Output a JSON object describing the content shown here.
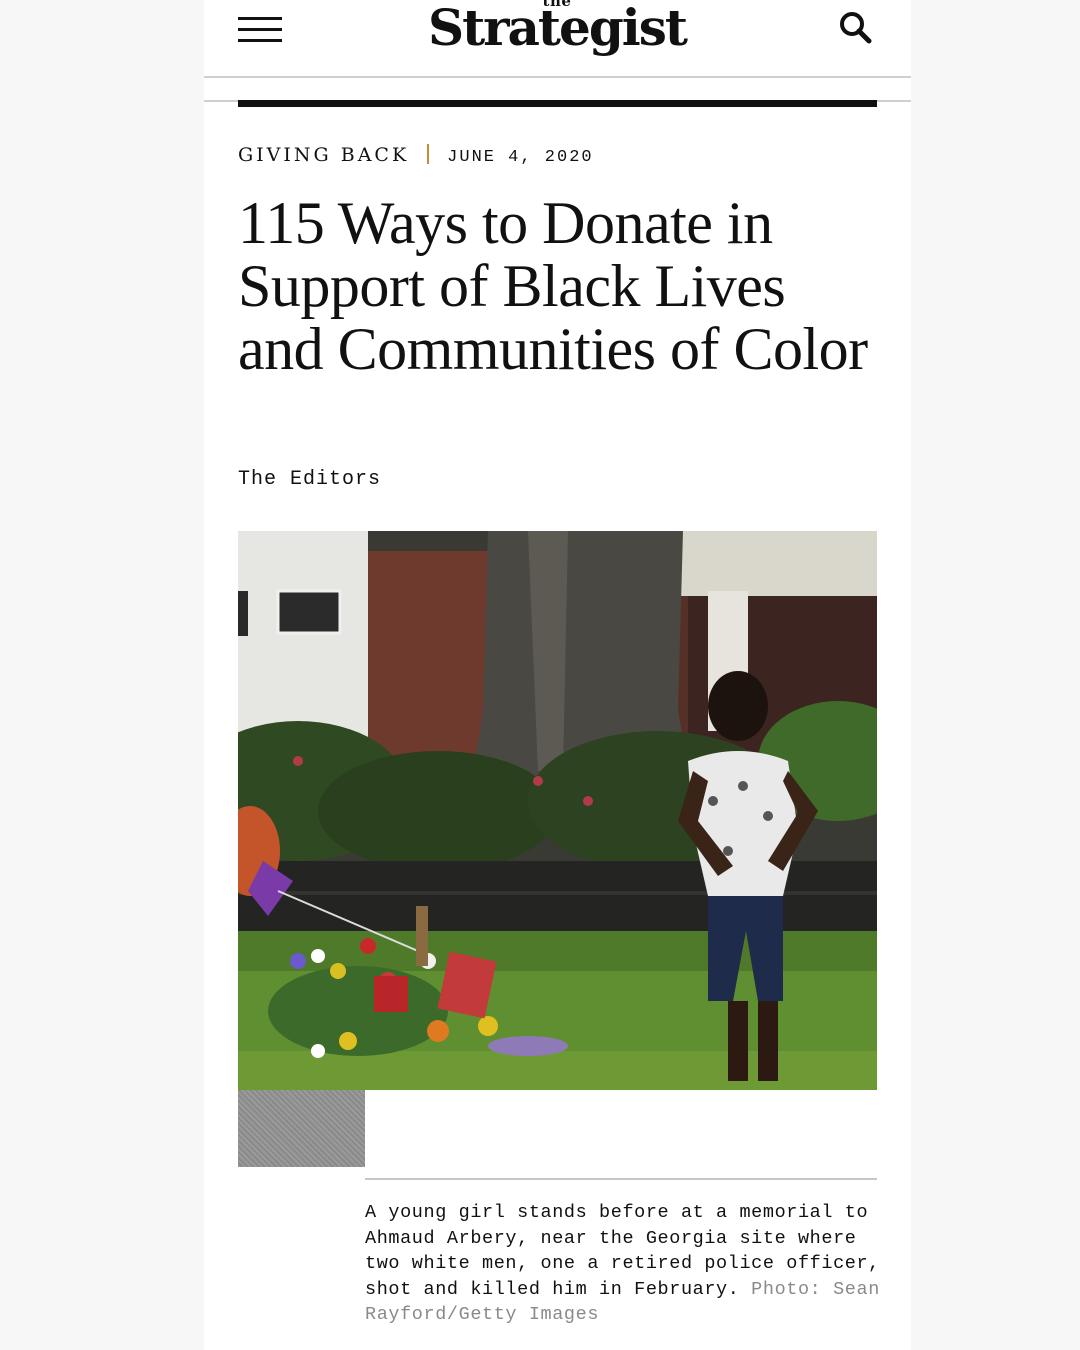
{
  "header": {
    "logo_small": "the",
    "logo_main": "Strategist",
    "menu_icon": "hamburger-menu-icon",
    "search_icon": "search-icon"
  },
  "article": {
    "section": "GIVING BACK",
    "date": "JUNE 4, 2020",
    "headline": "115 Ways to Donate in Support of Black Lives and Communities of Color",
    "byline": "The Editors",
    "caption": "A young girl stands before at a memorial to Ahmaud Arbery, near the Georgia site where two white men, one a retired police officer, shot and killed him in February.",
    "caption_credit": "Photo: Sean Rayford/Getty Images"
  },
  "colors": {
    "separator_accent": "#c98a3a",
    "text": "#111111",
    "credit_gray": "#8a8a8a"
  }
}
